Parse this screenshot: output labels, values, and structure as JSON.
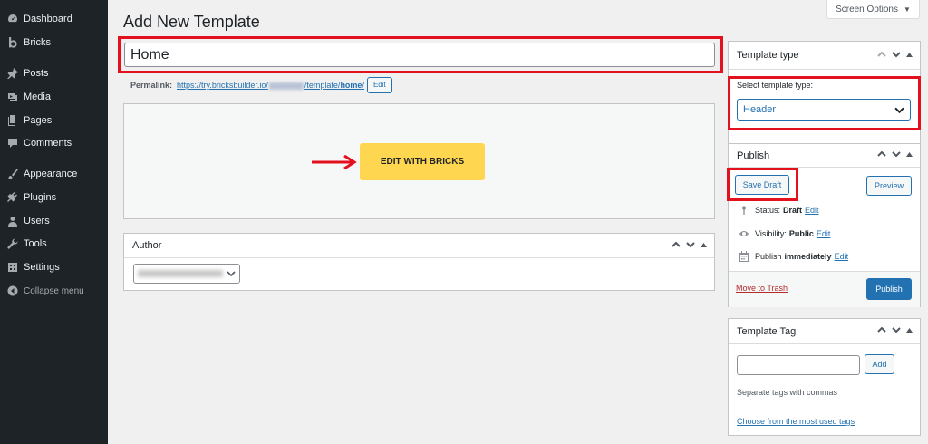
{
  "sidebar": {
    "items": [
      {
        "label": "Dashboard",
        "icon": "dashboard-icon"
      },
      {
        "label": "Bricks",
        "icon": "bricks-icon"
      },
      {
        "label": "Posts",
        "icon": "pin-icon"
      },
      {
        "label": "Media",
        "icon": "media-icon"
      },
      {
        "label": "Pages",
        "icon": "pages-icon"
      },
      {
        "label": "Comments",
        "icon": "comment-icon"
      },
      {
        "label": "Appearance",
        "icon": "paintbrush-icon"
      },
      {
        "label": "Plugins",
        "icon": "plugin-icon"
      },
      {
        "label": "Users",
        "icon": "user-icon"
      },
      {
        "label": "Tools",
        "icon": "wrench-icon"
      },
      {
        "label": "Settings",
        "icon": "settings-icon"
      },
      {
        "label": "Collapse menu",
        "icon": "collapse-icon"
      }
    ]
  },
  "header": {
    "title": "Add New Template",
    "screen_options": "Screen Options"
  },
  "title_field": {
    "value": "Home"
  },
  "permalink": {
    "label": "Permalink:",
    "url_prefix": "https://try.bricksbuilder.io/",
    "url_middle": "/template/",
    "url_slug": "home",
    "url_suffix": "/",
    "edit_label": "Edit"
  },
  "editor": {
    "button_label": "EDIT WITH BRICKS"
  },
  "author_box": {
    "title": "Author"
  },
  "template_type": {
    "title": "Template type",
    "label": "Select template type:",
    "selected": "Header"
  },
  "publish": {
    "title": "Publish",
    "save_draft": "Save Draft",
    "preview": "Preview",
    "status_label": "Status:",
    "status_value": "Draft",
    "visibility_label": "Visibility:",
    "visibility_value": "Public",
    "publish_label": "Publish",
    "publish_value": "immediately",
    "edit_label": "Edit",
    "trash": "Move to Trash",
    "publish_button": "Publish"
  },
  "template_tag": {
    "title": "Template Tag",
    "add": "Add",
    "help": "Separate tags with commas",
    "choose": "Choose from the most used tags"
  },
  "colors": {
    "accent": "#2271b1",
    "highlight": "#e3101d",
    "bricks_yellow": "#ffd64f",
    "sidebar_bg": "#1d2327"
  }
}
